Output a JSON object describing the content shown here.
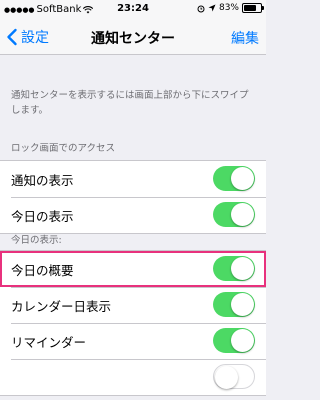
{
  "status_bar": {
    "signal_dots": "●●●●●",
    "carrier": "SoftBank",
    "time": "23:24",
    "battery_percent": "83%",
    "battery_level": 0.83
  },
  "nav": {
    "back_label": "設定",
    "title": "通知センター",
    "edit_label": "編集"
  },
  "info_text": "通知センターを表示するには画面上部から下にスワイプします。",
  "lock_section": {
    "header": "ロック画面でのアクセス",
    "rows": [
      {
        "label": "通知の表示",
        "on": true
      },
      {
        "label": "今日の表示",
        "on": true
      }
    ]
  },
  "today_section": {
    "header": "今日の表示:",
    "rows": [
      {
        "label": "今日の概要",
        "on": true
      },
      {
        "label": "カレンダー日表示",
        "on": true
      },
      {
        "label": "リマインダー",
        "on": true
      }
    ]
  },
  "colors": {
    "accent": "#007aff",
    "toggle_on": "#4cd964",
    "highlight": "#e8317d",
    "background": "#efeff4"
  }
}
